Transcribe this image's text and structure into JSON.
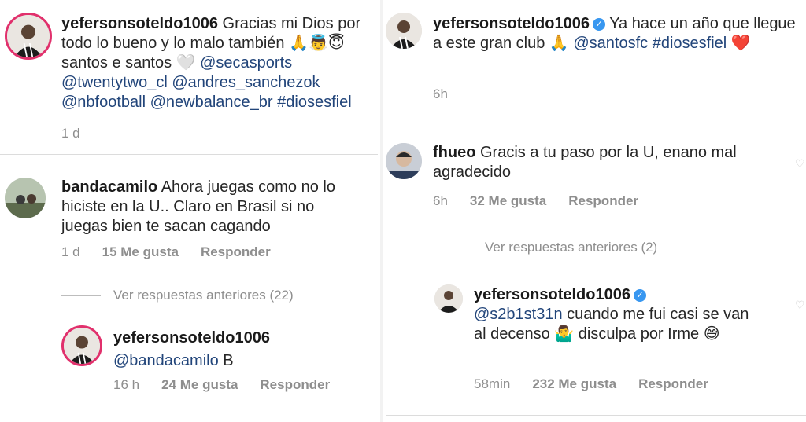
{
  "left": {
    "post": {
      "username": "yefersonsoteldo1006",
      "caption": "Gracias mi Dios por todo lo bueno y lo malo también",
      "caption_line2": "🙏👼😇 santos e santos 🤍",
      "mentions": [
        "@secasports",
        "@twentytwo_cl",
        "@andres_sanchezok",
        "@nbfootball",
        "@newbalance_br"
      ],
      "hashtag": "#diosesfiel",
      "time": "1 d"
    },
    "comment": {
      "username": "bandacamilo",
      "text": "Ahora juegas como no lo hiciste en la U.. Claro en Brasil si no juegas bien te sacan cagando",
      "time": "1 d",
      "likes": "15 Me gusta",
      "reply": "Responder"
    },
    "view_replies": "Ver respuestas anteriores (22)",
    "reply": {
      "username": "yefersonsoteldo1006",
      "mention": "@bandacamilo",
      "text": "B",
      "time": "16 h",
      "likes": "24 Me gusta",
      "reply": "Responder"
    }
  },
  "right": {
    "post": {
      "username": "yefersonsoteldo1006",
      "caption": "Ya hace un año que llegue a este gran club 🙏",
      "mention": "@santosfc",
      "hashtag": "#diosesfiel",
      "emoji": "❤️",
      "time": "6h"
    },
    "comment": {
      "username": "fhueo",
      "text": "Gracis a tu paso por la U, enano mal agradecido",
      "time": "6h",
      "likes": "32 Me gusta",
      "reply": "Responder"
    },
    "view_replies": "Ver respuestas anteriores (2)",
    "reply": {
      "username": "yefersonsoteldo1006",
      "mention": "@s2b1st31n",
      "text": "cuando me fui casi se van al decenso 🤷‍♂️ disculpa por Irme 😅",
      "time": "58min",
      "likes": "232 Me gusta",
      "reply": "Responder"
    }
  },
  "colors": {
    "text": "#262626",
    "mention": "#22457a",
    "meta": "#8e8e8e",
    "ring": "#e1306c",
    "verified": "#3897f0"
  }
}
